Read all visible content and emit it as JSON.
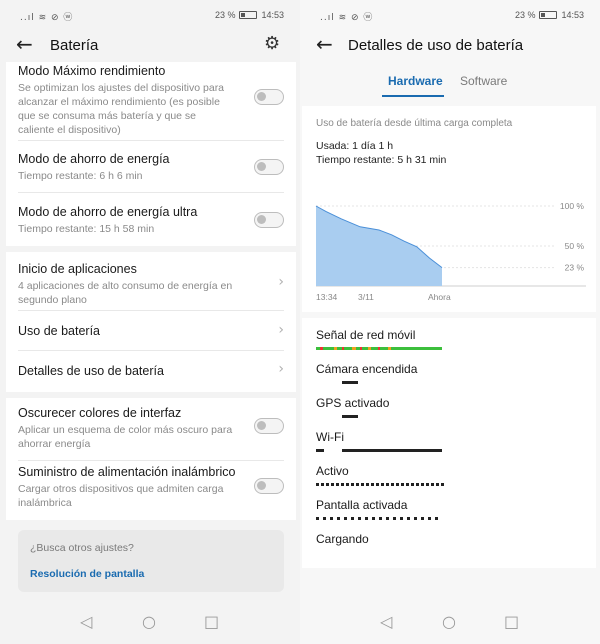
{
  "status": {
    "left_icons": "..ıl ≋ ⊘ ⓦ",
    "battery_pct": "23 %",
    "time": "14:53"
  },
  "left": {
    "title": "Batería",
    "items": [
      {
        "title": "Modo Máximo rendimiento",
        "sub": "Se optimizan los ajustes del dispositivo para alcanzar el máximo rendimiento (es posible que se consuma más batería y que se caliente el dispositivo)"
      },
      {
        "title": "Modo de ahorro de energía",
        "sub": "Tiempo restante: 6 h 6 min"
      },
      {
        "title": "Modo de ahorro de energía ultra",
        "sub": "Tiempo restante: 15 h 58 min"
      },
      {
        "title": "Inicio de aplicaciones",
        "sub": "4 aplicaciones de alto consumo de energía en segundo plano"
      },
      {
        "title": "Uso de batería",
        "sub": ""
      },
      {
        "title": "Detalles de uso de batería",
        "sub": ""
      },
      {
        "title": "Oscurecer colores de interfaz",
        "sub": "Aplicar un esquema de color más oscuro para ahorrar energía"
      },
      {
        "title": "Suministro de alimentación inalámbrico",
        "sub": "Cargar otros dispositivos que admiten carga inalámbrica"
      }
    ],
    "search": {
      "question": "¿Busca otros ajustes?",
      "link": "Resolución de pantalla"
    }
  },
  "right": {
    "title": "Detalles de uso de batería",
    "tabs": [
      "Hardware",
      "Software"
    ],
    "usage_heading": "Uso de batería desde última carga completa",
    "used": "Usada: 1 día 1 h",
    "remaining": "Tiempo restante: 5 h 31 min",
    "chart_data": {
      "type": "area",
      "x_ticks": [
        "13:34",
        "3/11",
        "Ahora"
      ],
      "y_ticks": [
        "100 %",
        "50 %",
        "23 %"
      ],
      "x": [
        0,
        0.08,
        0.2,
        0.35,
        0.5,
        0.6,
        0.7,
        0.8,
        0.9,
        1.0
      ],
      "values": [
        100,
        93,
        84,
        74,
        70,
        64,
        56,
        49,
        35,
        23
      ],
      "ylim": [
        0,
        100
      ],
      "color": "#a9cdf0",
      "line_color": "#4a8fd8"
    },
    "components": [
      {
        "name": "Señal de red móvil",
        "bar": "signal"
      },
      {
        "name": "Cámara encendida",
        "bar": "dot"
      },
      {
        "name": "GPS activado",
        "bar": "dot"
      },
      {
        "name": "Wi-Fi",
        "bar": "wifi"
      },
      {
        "name": "Activo",
        "bar": "dashed"
      },
      {
        "name": "Pantalla activada",
        "bar": "dashed2"
      },
      {
        "name": "Cargando",
        "bar": "none"
      }
    ]
  },
  "nav": {
    "back": "◁",
    "home": "○",
    "recent": "□"
  }
}
